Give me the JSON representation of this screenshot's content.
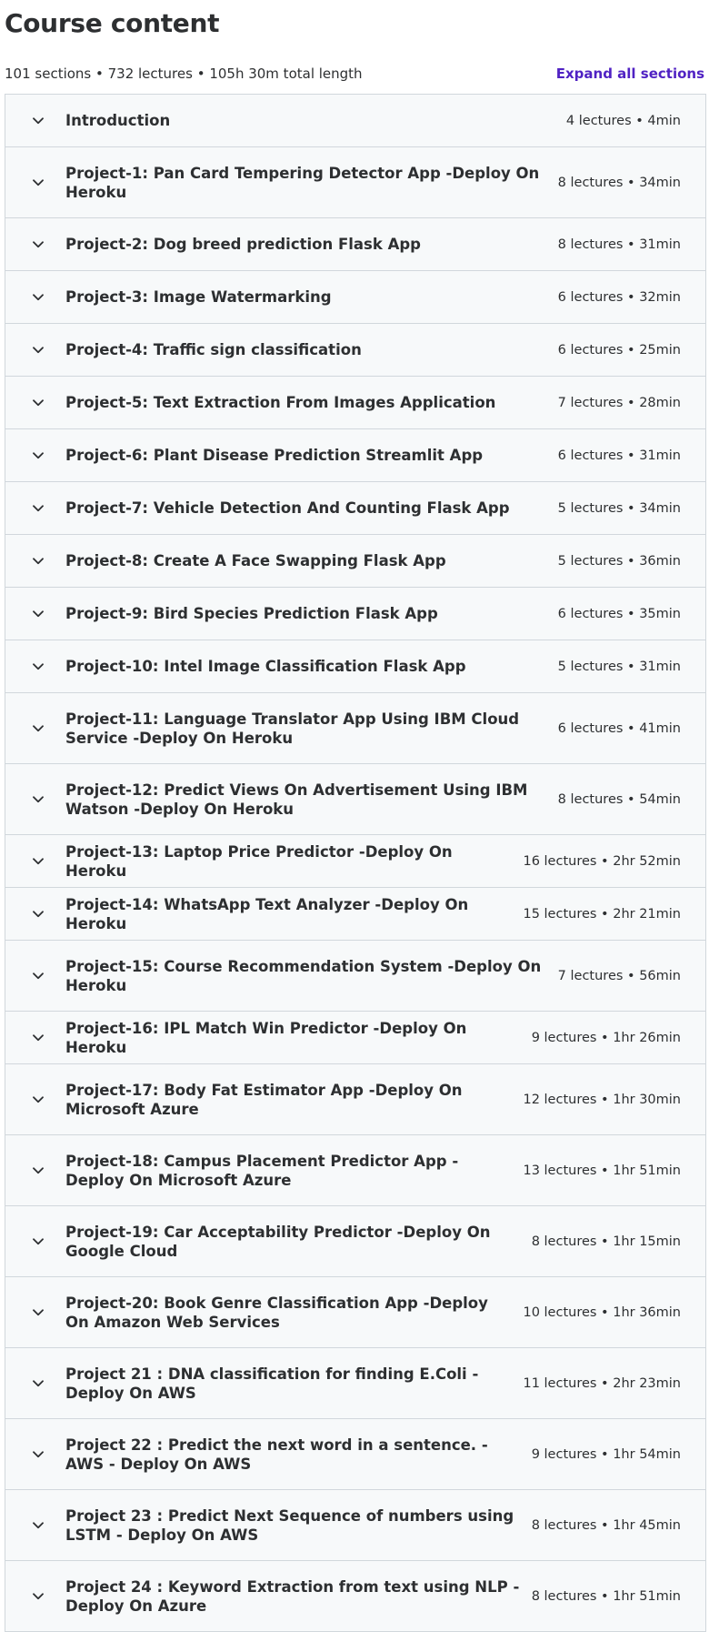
{
  "page": {
    "title": "Course content",
    "summary": "101 sections • 732 lectures • 105h 30m total length",
    "expand_label": "Expand all sections"
  },
  "colors": {
    "accent": "#5022c3",
    "section_bg": "#f7f9fa",
    "border": "#d1d7dc",
    "text": "#2d2f31"
  },
  "icons": {
    "section_toggle": "chevron-down-icon"
  },
  "sections": [
    {
      "title": "Introduction",
      "meta": "4 lectures • 4min"
    },
    {
      "title": "Project-1: Pan Card Tempering Detector App -Deploy On Heroku",
      "meta": "8 lectures • 34min"
    },
    {
      "title": "Project-2: Dog breed prediction Flask App",
      "meta": "8 lectures • 31min"
    },
    {
      "title": "Project-3: Image Watermarking",
      "meta": "6 lectures • 32min"
    },
    {
      "title": "Project-4: Traffic sign classification",
      "meta": "6 lectures • 25min"
    },
    {
      "title": "Project-5: Text Extraction From Images Application",
      "meta": "7 lectures • 28min"
    },
    {
      "title": "Project-6: Plant Disease Prediction Streamlit App",
      "meta": "6 lectures • 31min"
    },
    {
      "title": "Project-7: Vehicle Detection And Counting Flask App",
      "meta": "5 lectures • 34min"
    },
    {
      "title": "Project-8: Create A Face Swapping Flask App",
      "meta": "5 lectures • 36min"
    },
    {
      "title": "Project-9: Bird Species Prediction Flask App",
      "meta": "6 lectures • 35min"
    },
    {
      "title": "Project-10: Intel Image Classification Flask App",
      "meta": "5 lectures • 31min"
    },
    {
      "title": "Project-11: Language Translator App Using IBM Cloud Service -Deploy On Heroku",
      "meta": "6 lectures • 41min"
    },
    {
      "title": "Project-12: Predict Views On Advertisement Using IBM Watson -Deploy On Heroku",
      "meta": "8 lectures • 54min"
    },
    {
      "title": "Project-13: Laptop Price Predictor -Deploy On Heroku",
      "meta": "16 lectures • 2hr 52min"
    },
    {
      "title": "Project-14: WhatsApp Text Analyzer -Deploy On Heroku",
      "meta": "15 lectures • 2hr 21min"
    },
    {
      "title": "Project-15: Course Recommendation System -Deploy On Heroku",
      "meta": "7 lectures • 56min"
    },
    {
      "title": "Project-16: IPL Match Win Predictor -Deploy On Heroku",
      "meta": "9 lectures • 1hr 26min"
    },
    {
      "title": "Project-17: Body Fat Estimator App -Deploy On Microsoft Azure",
      "meta": "12 lectures • 1hr 30min"
    },
    {
      "title": "Project-18: Campus Placement Predictor App -Deploy On Microsoft Azure",
      "meta": "13 lectures • 1hr 51min"
    },
    {
      "title": "Project-19: Car Acceptability Predictor -Deploy On Google Cloud",
      "meta": "8 lectures • 1hr 15min"
    },
    {
      "title": "Project-20: Book Genre Classification App -Deploy On Amazon Web Services",
      "meta": "10 lectures • 1hr 36min"
    },
    {
      "title": "Project 21 : DNA classification for finding E.Coli - Deploy On AWS",
      "meta": "11 lectures • 2hr 23min"
    },
    {
      "title": "Project 22 : Predict the next word in a sentence. - AWS - Deploy On AWS",
      "meta": "9 lectures • 1hr 54min"
    },
    {
      "title": "Project 23 : Predict Next Sequence of numbers using LSTM - Deploy On AWS",
      "meta": "8 lectures • 1hr 45min"
    },
    {
      "title": "Project 24 : Keyword Extraction from text using NLP - Deploy On Azure",
      "meta": "8 lectures • 1hr 51min"
    }
  ]
}
